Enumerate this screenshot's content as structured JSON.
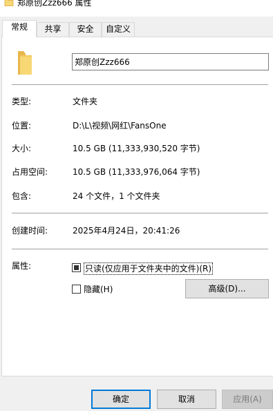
{
  "window": {
    "title": "郑原创Zzz666 属性"
  },
  "tabs": [
    {
      "label": "常规",
      "active": true
    },
    {
      "label": "共享",
      "active": false
    },
    {
      "label": "安全",
      "active": false
    },
    {
      "label": "自定义",
      "active": false
    }
  ],
  "general": {
    "icon": "folder-icon",
    "name_value": "郑原创Zzz666",
    "rows": [
      {
        "label": "类型:",
        "value": "文件夹"
      },
      {
        "label": "位置:",
        "value": "D:\\L\\视频\\网红\\FansOne"
      },
      {
        "label": "大小:",
        "value": "10.5 GB (11,333,930,520 字节)"
      },
      {
        "label": "占用空间:",
        "value": "10.5 GB (11,333,976,064 字节)"
      },
      {
        "label": "包含:",
        "value": "24 个文件，1 个文件夹"
      }
    ],
    "created_label": "创建时间:",
    "created_value": "2025年4月24日，20:41:26",
    "attributes_label": "属性:",
    "readonly_label": "只读(仅应用于文件夹中的文件)(R)",
    "readonly_state": "indeterminate",
    "hidden_label": "隐藏(H)",
    "hidden_checked": false,
    "advanced_label": "高级(D)..."
  },
  "buttons": {
    "ok": "确定",
    "cancel": "取消",
    "apply": "应用(A)"
  },
  "colors": {
    "folder": "#f8d775",
    "default_button_border": "#0078d7"
  }
}
